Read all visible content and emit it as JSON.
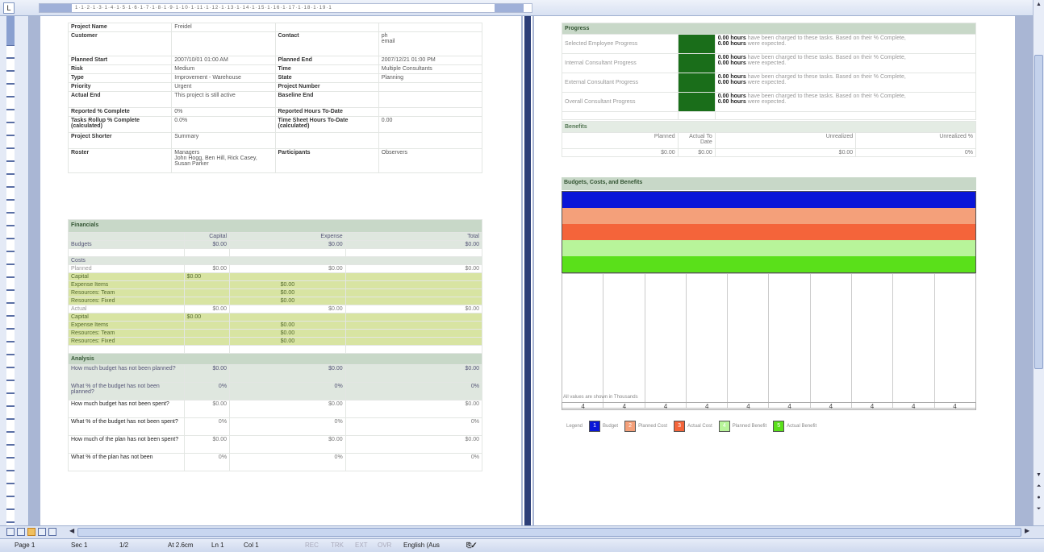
{
  "info": {
    "rows": [
      [
        "Project Name",
        "Freidel",
        "",
        ""
      ],
      [
        "Customer",
        "",
        "Contact",
        "ph\nemail"
      ],
      [
        "Planned Start",
        "2007/10/01 01:00 AM",
        "Planned End",
        "2007/12/21 01:00 PM"
      ],
      [
        "Risk",
        "Medium",
        "Time",
        "Multiple Consultants"
      ],
      [
        "Type",
        "Improvement - Warehouse",
        "State",
        "Planning"
      ],
      [
        "Priority",
        "Urgent",
        "Project Number",
        ""
      ],
      [
        "Actual End",
        "This project is still active",
        "Baseline End",
        ""
      ],
      [
        "Reported % Complete",
        "0%",
        "Reported Hours To-Date",
        ""
      ],
      [
        "Tasks Rollup % Complete (calculated)",
        "0.0%",
        "Time Sheet Hours To-Date (calculated)",
        "0.00"
      ],
      [
        "Project Shorter",
        "Summary",
        "",
        ""
      ],
      [
        "Roster",
        "Managers\nJohn Hogg, Ben Hill, Rick Casey, Susan Parker",
        "Participants",
        "Observers"
      ]
    ]
  },
  "financials": {
    "title": "Financials",
    "headers": [
      "",
      "Capital",
      "Expense",
      "Total"
    ],
    "budgets": {
      "label": "Budgets",
      "values": [
        "$0.00",
        "$0.00",
        "$0.00"
      ]
    },
    "costs_label": "Costs",
    "planned": {
      "label": "Planned",
      "values": [
        "$0.00",
        "$0.00",
        "$0.00"
      ]
    },
    "planned_detail": [
      {
        "label": "Capital",
        "cap": "$0.00",
        "exp": ""
      },
      {
        "label": "Expense Items",
        "cap": "",
        "exp": "$0.00"
      },
      {
        "label": "Resources: Team",
        "cap": "",
        "exp": "$0.00"
      },
      {
        "label": "Resources: Fixed",
        "cap": "",
        "exp": "$0.00"
      }
    ],
    "actual": {
      "label": "Actual",
      "values": [
        "$0.00",
        "$0.00",
        "$0.00"
      ]
    },
    "actual_detail": [
      {
        "label": "Capital",
        "cap": "$0.00",
        "exp": ""
      },
      {
        "label": "Expense Items",
        "cap": "",
        "exp": "$0.00"
      },
      {
        "label": "Resources: Team",
        "cap": "",
        "exp": "$0.00"
      },
      {
        "label": "Resources: Fixed",
        "cap": "",
        "exp": "$0.00"
      }
    ],
    "analysis_label": "Analysis",
    "analysis": [
      {
        "q": "How much budget has not been planned?",
        "values": [
          "$0.00",
          "$0.00",
          "$0.00"
        ]
      },
      {
        "q": "What % of the budget has not been planned?",
        "values": [
          "0%",
          "0%",
          "0%"
        ]
      },
      {
        "q": "How much budget has not been spent?",
        "values": [
          "$0.00",
          "$0.00",
          "$0.00"
        ]
      },
      {
        "q": "What % of the budget has not been spent?",
        "values": [
          "0%",
          "0%",
          "0%"
        ]
      },
      {
        "q": "How much of the plan has not been spent?",
        "values": [
          "$0.00",
          "$0.00",
          "$0.00"
        ]
      },
      {
        "q": "What % of the plan has not been",
        "values": [
          "0%",
          "0%",
          "0%"
        ]
      }
    ]
  },
  "progress": {
    "title": "Progress",
    "rows": [
      {
        "label": "Selected Employee Progress",
        "status": "green",
        "hours": "0.00 hours",
        "text": "have been charged to these tasks. Based on their % Complete,",
        "hours2": "0.00 hours",
        "text2": "were expected."
      },
      {
        "label": "Internal Consultant Progress",
        "status": "green",
        "hours": "0.00 hours",
        "text": "have been charged to these tasks. Based on their % Complete,",
        "hours2": "0.00 hours",
        "text2": "were expected."
      },
      {
        "label": "External Consultant Progress",
        "status": "green",
        "hours": "0.00 hours",
        "text": "have been charged to these tasks. Based on their % Complete,",
        "hours2": "0.00 hours",
        "text2": "were expected."
      },
      {
        "label": "Overall Consultant Progress",
        "status": "green",
        "hours": "0.00 hours",
        "text": "have been charged to these tasks. Based on their % Complete,",
        "hours2": "0.00 hours",
        "text2": "were expected."
      }
    ]
  },
  "benefits": {
    "title": "Benefits",
    "headers": [
      "Planned",
      "Actual To Date",
      "Unrealized",
      "Unrealized %"
    ],
    "values": [
      "$0.00",
      "$0.00",
      "$0.00",
      "0%"
    ]
  },
  "chart": {
    "title": "Budgets, Costs, and Benefits",
    "note": "All values are shown in Thousands",
    "legend_label": "Legend",
    "legend": [
      {
        "num": "1",
        "label": "Budget",
        "color": "#0a16d8"
      },
      {
        "num": "2",
        "label": "Planned Cost",
        "color": "#f4a07a"
      },
      {
        "num": "3",
        "label": "Actual Cost",
        "color": "#f4643a"
      },
      {
        "num": "4",
        "label": "Planned Benefit",
        "color": "#b8f49a"
      },
      {
        "num": "5",
        "label": "Actual Benefit",
        "color": "#5ae01a"
      }
    ],
    "axis_marks": [
      "4",
      "4",
      "4",
      "4",
      "4",
      "4",
      "4",
      "4",
      "4",
      "4"
    ]
  },
  "ruler": {
    "text": "1·1·2·1·3·1·4·1·5·1·6·1·7·1·8·1·9·1·10·1·11·1·12·1·13·1·14·1·15·1·16·1·17·1·18·1·19·1"
  },
  "status": {
    "page": "Page 1",
    "sec": "Sec 1",
    "pages": "1/2",
    "at": "At 2.6cm",
    "ln": "Ln 1",
    "col": "Col 1",
    "rec": "REC",
    "trk": "TRK",
    "ext": "EXT",
    "ovr": "OVR",
    "lang": "English (Aus"
  }
}
